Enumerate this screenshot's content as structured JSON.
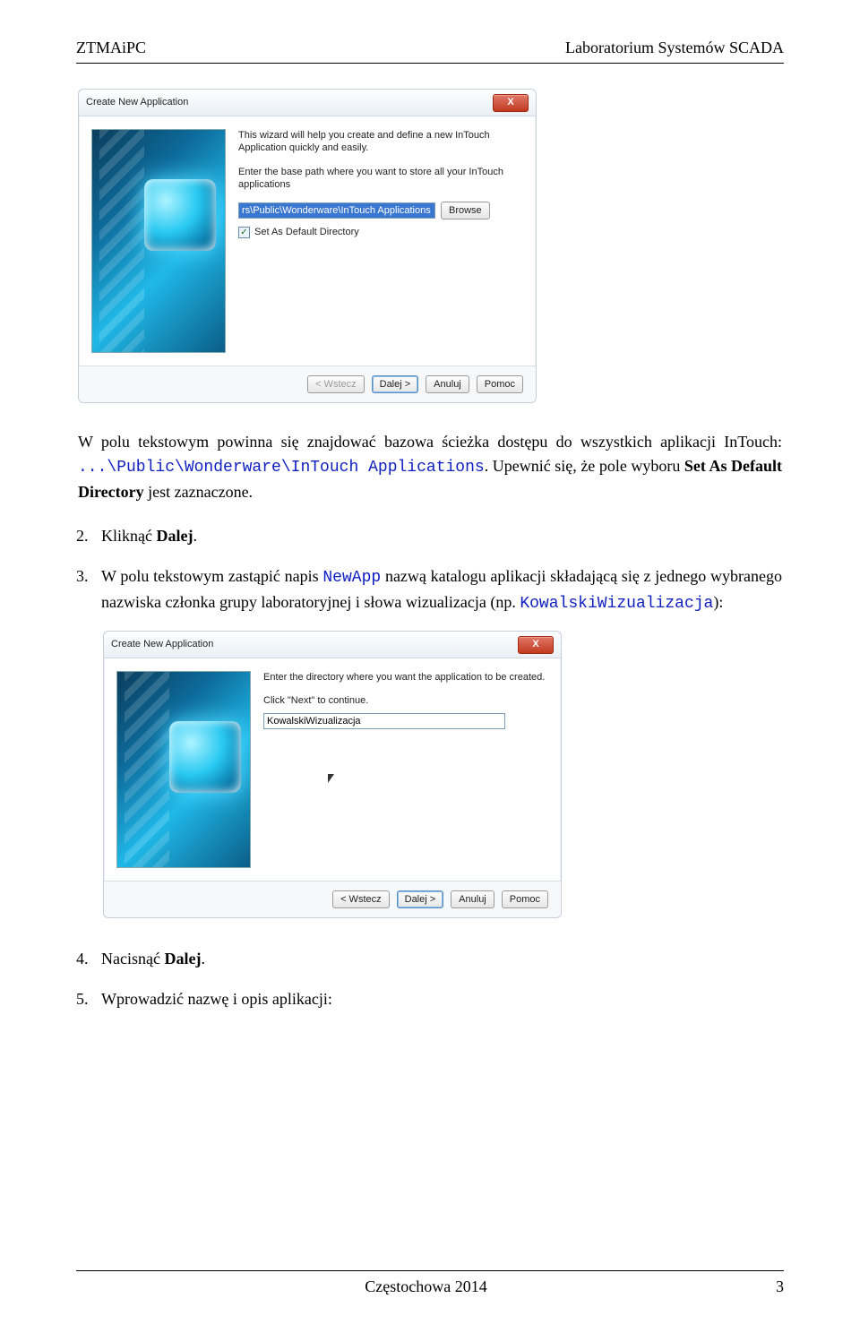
{
  "header": {
    "left": "ZTMAiPC",
    "right": "Laboratorium Systemów SCADA"
  },
  "dialog1": {
    "title": "Create New Application",
    "close": "X",
    "intro1": "This wizard will help you create and define a new InTouch Application quickly and easily.",
    "intro2": "Enter the base path where you want to store all your InTouch applications",
    "path": "rs\\Public\\Wonderware\\InTouch Applications",
    "browse": "Browse",
    "chk_label": "Set As Default Directory",
    "btn_back": "< Wstecz",
    "btn_next": "Dalej >",
    "btn_cancel": "Anuluj",
    "btn_help": "Pomoc"
  },
  "para1": {
    "t1": "W polu tekstowym powinna się znajdować bazowa ścieżka dostępu do wszystkich aplikacji InTouch: ",
    "code": "...\\Public\\Wonderware\\InTouch Applications",
    "t2": ". Upewnić się, że pole wyboru ",
    "b1": "Set As Default Directory",
    "t3": " jest zaznaczone."
  },
  "step2": {
    "t1": "Kliknąć ",
    "b1": "Dalej",
    "t2": "."
  },
  "step3": {
    "t1": "W polu tekstowym zastąpić napis ",
    "code1": "NewApp",
    "t2": " nazwą katalogu aplikacji składającą się z jednego wybranego nazwiska członka grupy laboratoryjnej i słowa wizualizacja (np. ",
    "code2": "KowalskiWizualizacja",
    "t3": "):"
  },
  "dialog2": {
    "title": "Create New Application",
    "close": "X",
    "intro1": "Enter the directory where you want the application to be created.",
    "intro2": "Click \"Next\" to continue.",
    "path": "KowalskiWizualizacja",
    "btn_back": "< Wstecz",
    "btn_next": "Dalej >",
    "btn_cancel": "Anuluj",
    "btn_help": "Pomoc"
  },
  "step4": {
    "t1": "Nacisnąć ",
    "b1": "Dalej",
    "t2": "."
  },
  "step5": {
    "t1": "Wprowadzić nazwę i opis aplikacji:"
  },
  "footer": {
    "center": "Częstochowa 2014",
    "pagenum": "3"
  }
}
